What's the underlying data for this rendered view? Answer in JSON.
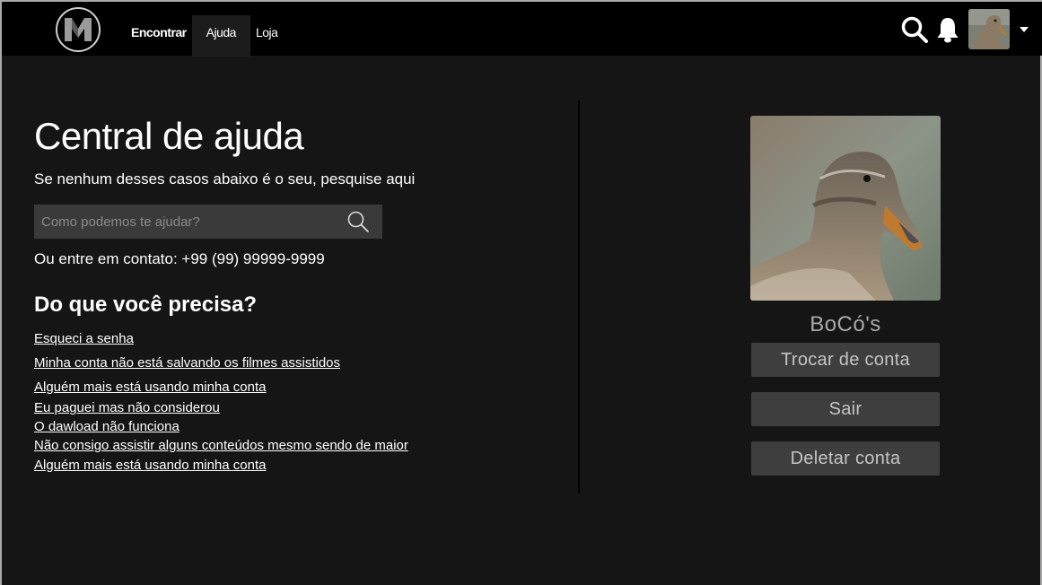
{
  "header": {
    "logo_letter": "M",
    "nav": [
      {
        "label": "Encontrar"
      },
      {
        "label": "Ajuda"
      },
      {
        "label": "Loja"
      }
    ],
    "icons": [
      "search-icon",
      "bell-icon",
      "avatar",
      "caret-down-icon"
    ]
  },
  "help": {
    "title": "Central de ajuda",
    "subtitle": "Se nenhum desses casos abaixo é o seu, pesquise aqui",
    "search_placeholder": "Como podemos te ajudar?",
    "contact": "Ou entre em contato: +99 (99) 99999-9999",
    "section_title": "Do que você precisa?",
    "links": [
      "Esqueci a senha",
      "Minha conta não está salvando os filmes assistidos",
      "Alguém mais está usando minha conta",
      "Eu paguei mas não considerou",
      "O dawload não funciona",
      "Não consigo assistir alguns conteúdos mesmo sendo de maior",
      "Alguém mais está usando minha conta"
    ]
  },
  "profile": {
    "name": "BoCó's",
    "buttons": {
      "switch": "Trocar de conta",
      "logout": "Sair",
      "delete": "Deletar conta"
    }
  },
  "colors": {
    "background": "#151515",
    "topbar": "#000000",
    "button": "#3e3e3e",
    "search_field": "#3a3a3a"
  }
}
